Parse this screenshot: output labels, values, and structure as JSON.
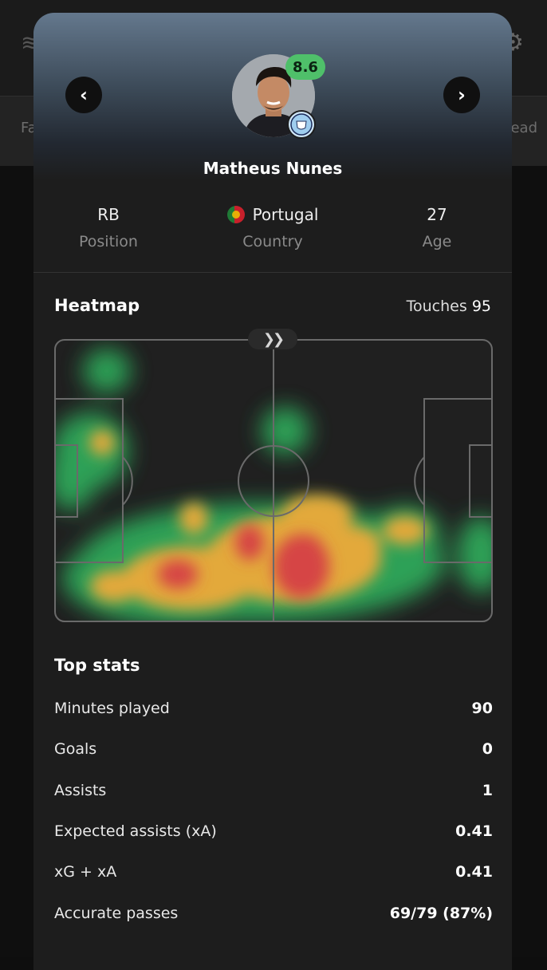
{
  "background": {
    "tab_left": "Fa",
    "tab_right": "ead"
  },
  "player": {
    "name": "Matheus Nunes",
    "rating": "8.6",
    "rating_color": "#4fc06a"
  },
  "info": [
    {
      "value": "RB",
      "label": "Position"
    },
    {
      "value": "Portugal",
      "label": "Country",
      "icon": "portugal-flag-icon"
    },
    {
      "value": "27",
      "label": "Age"
    }
  ],
  "heatmap": {
    "title": "Heatmap",
    "touches_label": "Touches",
    "touches_value": "95",
    "direction_icon": "chevron-right-icon"
  },
  "top_stats": {
    "title": "Top stats",
    "rows": [
      {
        "label": "Minutes played",
        "value": "90"
      },
      {
        "label": "Goals",
        "value": "0"
      },
      {
        "label": "Assists",
        "value": "1"
      },
      {
        "label": "Expected assists (xA)",
        "value": "0.41"
      },
      {
        "label": "xG + xA",
        "value": "0.41"
      },
      {
        "label": "Accurate passes",
        "value": "69/79 (87%)"
      }
    ]
  }
}
